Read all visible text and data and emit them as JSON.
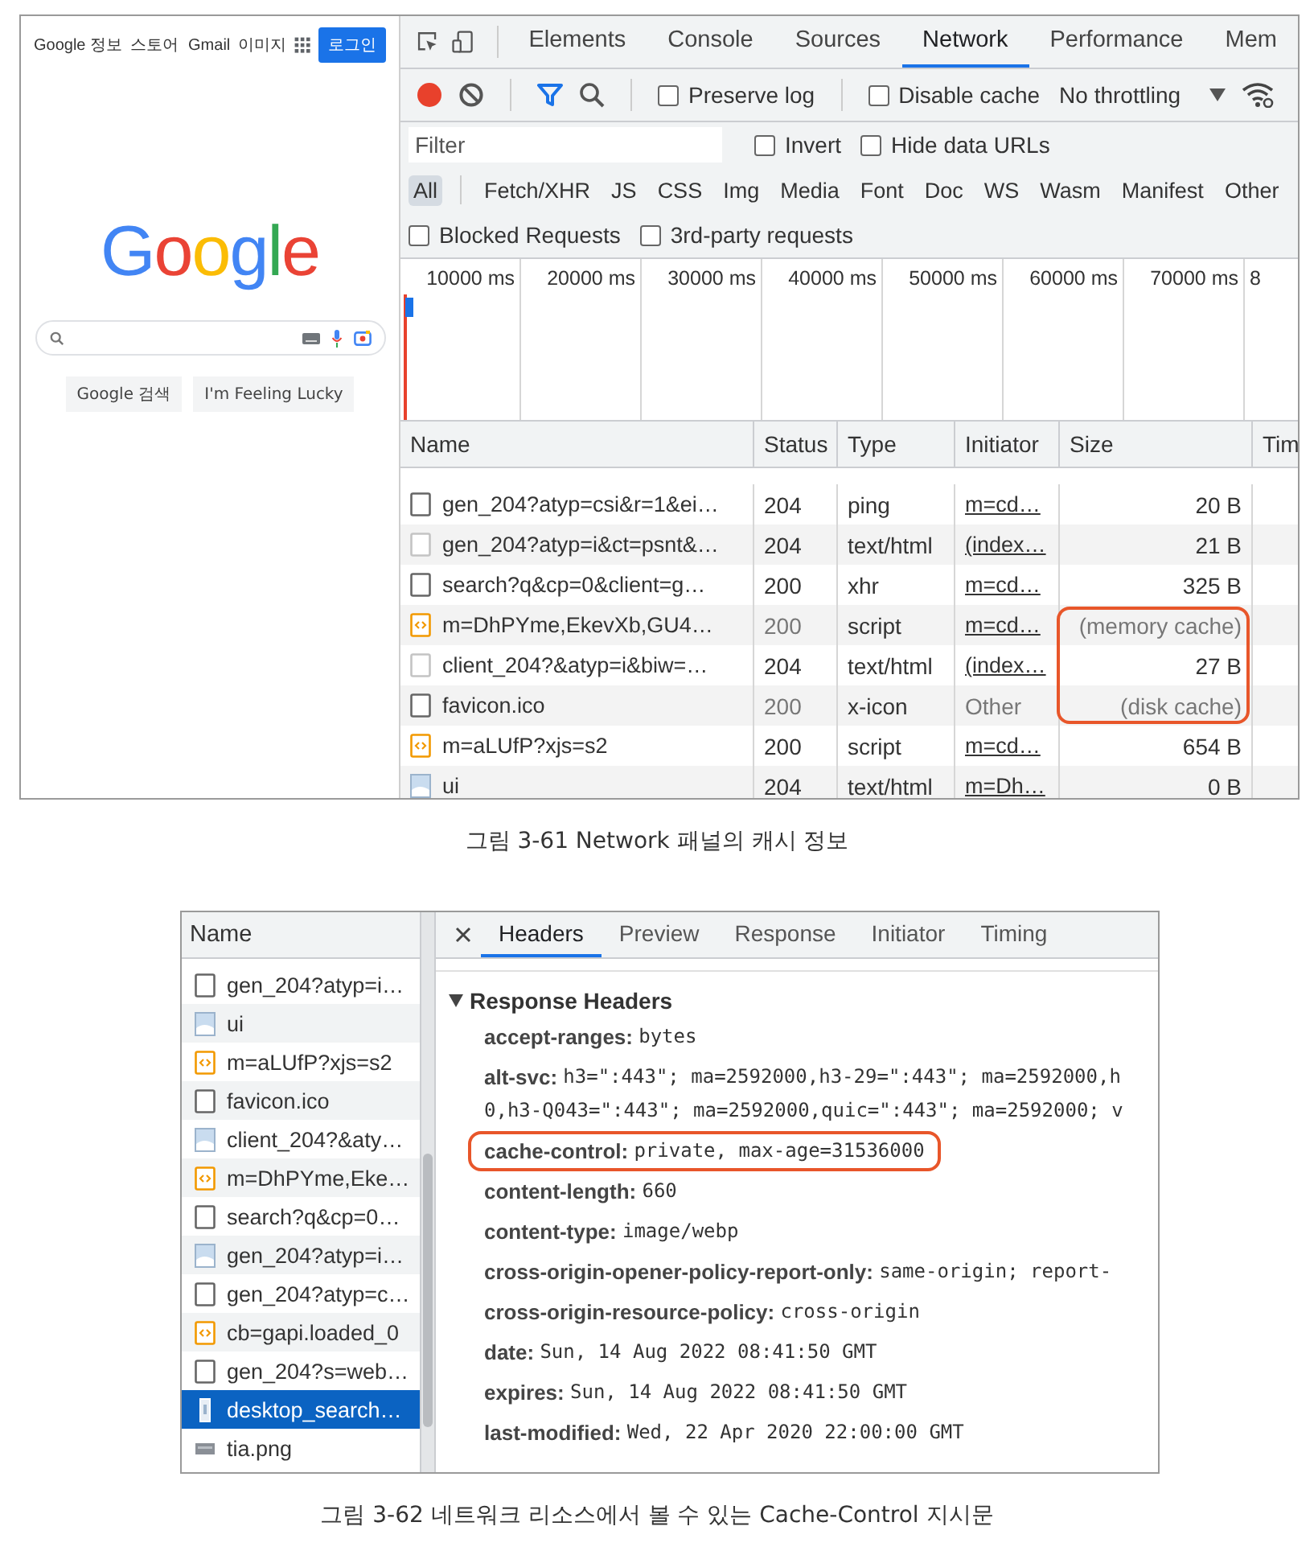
{
  "network_figure": {
    "browser": {
      "left_links": [
        "Google 정보",
        "스토어"
      ],
      "right_links": [
        "Gmail",
        "이미지"
      ],
      "sign_in": "로그인",
      "logo": "Google",
      "buttons": [
        "Google 검색",
        "I'm Feeling Lucky"
      ]
    },
    "devtools": {
      "tabs": [
        {
          "label": "Elements",
          "selected": false
        },
        {
          "label": "Console",
          "selected": false
        },
        {
          "label": "Sources",
          "selected": false
        },
        {
          "label": "Network",
          "selected": true
        },
        {
          "label": "Performance",
          "selected": false
        },
        {
          "label": "Mem",
          "selected": false
        }
      ],
      "recording": true,
      "toolbar_checkboxes": [
        {
          "label": "Preserve log",
          "checked": false
        },
        {
          "label": "Disable cache",
          "checked": false
        }
      ],
      "throttling": "No throttling",
      "filter": {
        "placeholder": "Filter"
      },
      "filter_checkboxes": [
        {
          "label": "Invert",
          "checked": false
        },
        {
          "label": "Hide data URLs",
          "checked": false
        }
      ],
      "type_filters": [
        {
          "label": "All",
          "selected": true
        },
        {
          "label": "Fetch/XHR",
          "selected": false
        },
        {
          "label": "JS",
          "selected": false
        },
        {
          "label": "CSS",
          "selected": false
        },
        {
          "label": "Img",
          "selected": false
        },
        {
          "label": "Media",
          "selected": false
        },
        {
          "label": "Font",
          "selected": false
        },
        {
          "label": "Doc",
          "selected": false
        },
        {
          "label": "WS",
          "selected": false
        },
        {
          "label": "Wasm",
          "selected": false
        },
        {
          "label": "Manifest",
          "selected": false
        },
        {
          "label": "Other",
          "selected": false
        }
      ],
      "extra_checkboxes": [
        {
          "label": "Blocked Requests",
          "checked": false
        },
        {
          "label": "3rd-party requests",
          "checked": false
        }
      ],
      "timeline_ticks": [
        "10000 ms",
        "20000 ms",
        "30000 ms",
        "40000 ms",
        "50000 ms",
        "60000 ms",
        "70000 ms",
        "8"
      ],
      "columns": [
        "Name",
        "Status",
        "Type",
        "Initiator",
        "Size",
        "Tim"
      ],
      "rows": [
        {
          "kind": "document",
          "name": "gen_204?atyp=csi&r=1&ei…",
          "status": "204",
          "type": "ping",
          "initiator": "m=cd…",
          "initiator_link": true,
          "size": "20 B",
          "cached": false,
          "highlighted": false
        },
        {
          "kind": "blank",
          "name": "gen_204?atyp=i&ct=psnt&…",
          "status": "204",
          "type": "text/html",
          "initiator": "(index…",
          "initiator_link": true,
          "size": "21 B",
          "cached": false,
          "highlighted": false
        },
        {
          "kind": "document",
          "name": "search?q&cp=0&client=g…",
          "status": "200",
          "type": "xhr",
          "initiator": "m=cd…",
          "initiator_link": true,
          "size": "325 B",
          "cached": false,
          "highlighted": false
        },
        {
          "kind": "script",
          "name": "m=DhPYme,EkevXb,GU4…",
          "status": "200",
          "type": "script",
          "initiator": "m=cd…",
          "initiator_link": true,
          "size": "(memory cache)",
          "cached": true,
          "highlighted": true
        },
        {
          "kind": "blank",
          "name": "client_204?&atyp=i&biw=…",
          "status": "204",
          "type": "text/html",
          "initiator": "(index…",
          "initiator_link": true,
          "size": "27 B",
          "cached": false,
          "highlighted": true
        },
        {
          "kind": "document",
          "name": "favicon.ico",
          "status": "200",
          "type": "x-icon",
          "initiator": "Other",
          "initiator_link": false,
          "size": "(disk cache)",
          "cached": true,
          "highlighted": true
        },
        {
          "kind": "script",
          "name": "m=aLUfP?xjs=s2",
          "status": "200",
          "type": "script",
          "initiator": "m=cd…",
          "initiator_link": true,
          "size": "654 B",
          "cached": false,
          "highlighted": false
        },
        {
          "kind": "image",
          "name": "ui",
          "status": "204",
          "type": "text/html",
          "initiator": "m=Dh…",
          "initiator_link": true,
          "size": "0 B",
          "cached": false,
          "highlighted": false
        }
      ]
    },
    "caption": "그림 3-61 Network 패널의 캐시 정보"
  },
  "headers_figure": {
    "list_title": "Name",
    "requests": [
      {
        "kind": "document",
        "name": "gen_204?atyp=i…",
        "selected": false
      },
      {
        "kind": "image",
        "name": "ui",
        "selected": false
      },
      {
        "kind": "script",
        "name": "m=aLUfP?xjs=s2",
        "selected": false
      },
      {
        "kind": "document",
        "name": "favicon.ico",
        "selected": false
      },
      {
        "kind": "image",
        "name": "client_204?&aty…",
        "selected": false
      },
      {
        "kind": "script",
        "name": "m=DhPYme,Eke…",
        "selected": false
      },
      {
        "kind": "document",
        "name": "search?q&cp=0…",
        "selected": false
      },
      {
        "kind": "image",
        "name": "gen_204?atyp=i…",
        "selected": false
      },
      {
        "kind": "document",
        "name": "gen_204?atyp=c…",
        "selected": false
      },
      {
        "kind": "script",
        "name": "cb=gapi.loaded_0",
        "selected": false
      },
      {
        "kind": "document",
        "name": "gen_204?s=web…",
        "selected": false
      },
      {
        "kind": "tall-image",
        "name": "desktop_search…",
        "selected": true
      },
      {
        "kind": "thumbnail",
        "name": "tia.png",
        "selected": false
      }
    ],
    "tabs": [
      {
        "label": "Headers",
        "selected": true
      },
      {
        "label": "Preview",
        "selected": false
      },
      {
        "label": "Response",
        "selected": false
      },
      {
        "label": "Initiator",
        "selected": false
      },
      {
        "label": "Timing",
        "selected": false
      }
    ],
    "section_title": "Response Headers",
    "section_expanded": true,
    "headers": [
      {
        "name": "accept-ranges:",
        "value_lines": [
          "bytes"
        ],
        "highlighted": false
      },
      {
        "name": "alt-svc:",
        "value_lines": [
          "h3=\":443\"; ma=2592000,h3-29=\":443\"; ma=2592000,h",
          "0,h3-Q043=\":443\"; ma=2592000,quic=\":443\"; ma=2592000; v"
        ],
        "highlighted": false
      },
      {
        "name": "cache-control:",
        "value_lines": [
          "private, max-age=31536000"
        ],
        "highlighted": true
      },
      {
        "name": "content-length:",
        "value_lines": [
          "660"
        ],
        "highlighted": false
      },
      {
        "name": "content-type:",
        "value_lines": [
          "image/webp"
        ],
        "highlighted": false
      },
      {
        "name": "cross-origin-opener-policy-report-only:",
        "value_lines": [
          "same-origin; report-"
        ],
        "highlighted": false
      },
      {
        "name": "cross-origin-resource-policy:",
        "value_lines": [
          "cross-origin"
        ],
        "highlighted": false
      },
      {
        "name": "date:",
        "value_lines": [
          "Sun, 14 Aug 2022 08:41:50 GMT"
        ],
        "highlighted": false
      },
      {
        "name": "expires:",
        "value_lines": [
          "Sun, 14 Aug 2022 08:41:50 GMT"
        ],
        "highlighted": false
      },
      {
        "name": "last-modified:",
        "value_lines": [
          "Wed, 22 Apr 2020 22:00:00 GMT"
        ],
        "highlighted": false
      }
    ],
    "caption": "그림 3-62 네트워크 리소스에서 볼 수 있는 Cache-Control 지시문"
  }
}
